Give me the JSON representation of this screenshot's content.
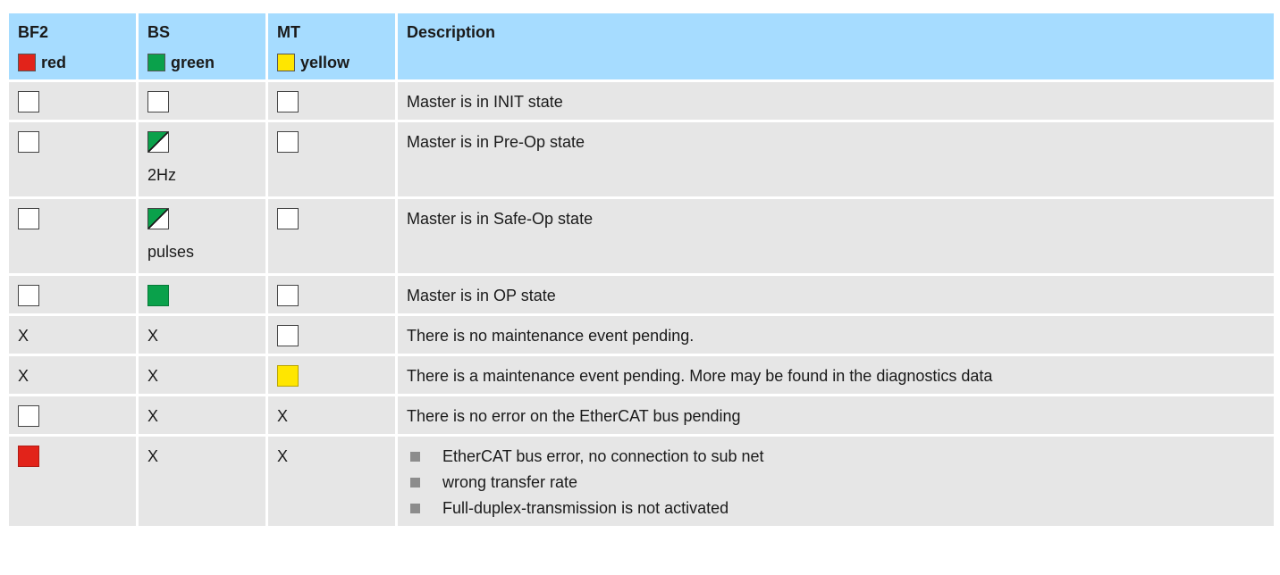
{
  "header": {
    "columns": [
      {
        "title": "BF2",
        "color_label": "red",
        "swatch": "#e2231a"
      },
      {
        "title": "BS",
        "color_label": "green",
        "swatch": "#0aa14b"
      },
      {
        "title": "MT",
        "color_label": "yellow",
        "swatch": "#ffe600"
      },
      {
        "title": "Description"
      }
    ]
  },
  "colors": {
    "header_bg": "#a6dcff",
    "row_bg": "#e6e6e6",
    "led_off": "#ffffff",
    "led_red": "#e2231a",
    "led_green": "#0aa14b",
    "led_yellow": "#ffe600",
    "bullet": "#8c8c8c"
  },
  "rows": [
    {
      "bf2": {
        "state": "off"
      },
      "bs": {
        "state": "off"
      },
      "mt": {
        "state": "off"
      },
      "description": "Master is in INIT state"
    },
    {
      "bf2": {
        "state": "off"
      },
      "bs": {
        "state": "blink",
        "note": "2Hz"
      },
      "mt": {
        "state": "off"
      },
      "description": "Master is in Pre-Op state"
    },
    {
      "bf2": {
        "state": "off"
      },
      "bs": {
        "state": "blink",
        "note": "pulses"
      },
      "mt": {
        "state": "off"
      },
      "description": "Master is in Safe-Op state"
    },
    {
      "bf2": {
        "state": "off"
      },
      "bs": {
        "state": "on-green"
      },
      "mt": {
        "state": "off"
      },
      "description": "Master is in OP state"
    },
    {
      "bf2": {
        "state": "x",
        "text": "X"
      },
      "bs": {
        "state": "x",
        "text": "X"
      },
      "mt": {
        "state": "off"
      },
      "description": "There is no maintenance event pending."
    },
    {
      "bf2": {
        "state": "x",
        "text": "X"
      },
      "bs": {
        "state": "x",
        "text": "X"
      },
      "mt": {
        "state": "on-yellow"
      },
      "description": "There is a maintenance event pending. More may be found in the diagnostics data"
    },
    {
      "bf2": {
        "state": "off"
      },
      "bs": {
        "state": "x",
        "text": "X"
      },
      "mt": {
        "state": "x",
        "text": "X"
      },
      "description": "There is no error on the EtherCAT bus pending"
    },
    {
      "bf2": {
        "state": "on-red"
      },
      "bs": {
        "state": "x",
        "text": "X"
      },
      "mt": {
        "state": "x",
        "text": "X"
      },
      "description_items": [
        "EtherCAT bus error, no connection to sub net",
        "wrong transfer rate",
        "Full-duplex-transmission is not activated"
      ]
    }
  ]
}
